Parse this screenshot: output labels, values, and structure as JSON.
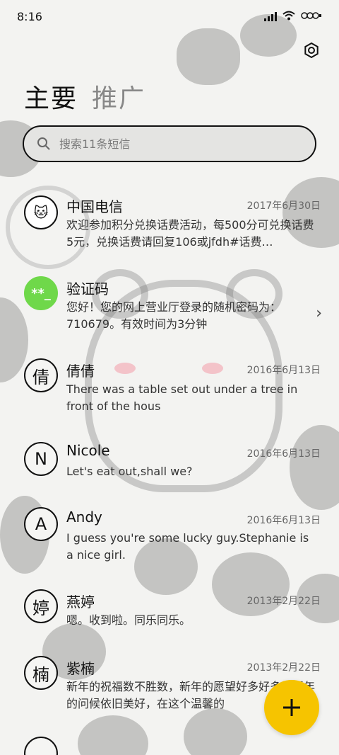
{
  "status_bar": {
    "time": "8:16"
  },
  "tabs": [
    {
      "label": "主要"
    },
    {
      "label": "推广"
    }
  ],
  "search": {
    "placeholder": "搜索11条短信"
  },
  "conversations": [
    {
      "avatar": "🐱",
      "name": "中国电信",
      "date": "2017年6月30日",
      "snippet": "欢迎参加积分兑换话费活动，每500分可兑换话费5元，兑换话费请回复106或jfdh#话费…"
    },
    {
      "avatar": "**_",
      "name": "验证码",
      "date": "",
      "snippet": "您好！您的网上营业厅登录的随机密码为：710679。有效时间为3分钟",
      "chevron": "›"
    },
    {
      "avatar": "倩",
      "name": "倩倩",
      "date": "2016年6月13日",
      "snippet": "There was a table set out under a tree in front of the hous"
    },
    {
      "avatar": "N",
      "name": "Nicole",
      "date": "2016年6月13日",
      "snippet": "Let's eat out,shall we?"
    },
    {
      "avatar": "A",
      "name": "Andy",
      "date": "2016年6月13日",
      "snippet": "I guess you're some lucky guy.Stephanie is a nice girl."
    },
    {
      "avatar": "婷",
      "name": "燕婷",
      "date": "2013年2月22日",
      "snippet": "嗯。收到啦。同乐同乐。"
    },
    {
      "avatar": "楠",
      "name": "紫楠",
      "date": "2013年2月22日",
      "snippet": "新年的祝福数不胜数，新年的愿望好多好多，新年的问候依旧美好，在这个温馨的"
    }
  ],
  "fab": {
    "label": "+"
  },
  "colors": {
    "fab": "#f6c400",
    "verify_avatar": "#6fd84a"
  }
}
